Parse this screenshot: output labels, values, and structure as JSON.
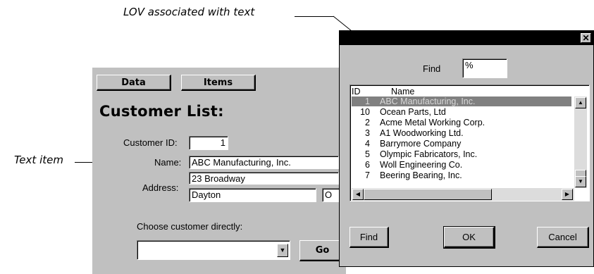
{
  "callouts": {
    "lov": "LOV associated with text",
    "text_item": "Text item"
  },
  "form": {
    "buttons": {
      "data": "Data",
      "items": "Items"
    },
    "title": "Customer List:",
    "customer_id_label": "Customer ID:",
    "customer_id_value": "1",
    "name_label": "Name:",
    "name_value": "ABC Manufacturing, Inc.",
    "address_label": "Address:",
    "address_line1": "23 Broadway",
    "city_value": "Dayton",
    "state_partial": "O",
    "choose_label": "Choose customer directly:",
    "combo_value": "",
    "go_label": "Go"
  },
  "lov_dialog": {
    "close_glyph": "✕",
    "find_label": "Find",
    "find_value": "%",
    "columns": {
      "id": "ID",
      "name": "Name"
    },
    "rows": [
      {
        "id": "1",
        "name": "ABC Manufacturing, Inc.",
        "selected": true
      },
      {
        "id": "10",
        "name": "Ocean Parts, Ltd"
      },
      {
        "id": "2",
        "name": "Acme Metal Working Corp."
      },
      {
        "id": "3",
        "name": "A1 Woodworking Ltd."
      },
      {
        "id": "4",
        "name": "Barrymore Company"
      },
      {
        "id": "5",
        "name": "Olympic Fabricators, Inc."
      },
      {
        "id": "6",
        "name": "Woll Engineering Co."
      },
      {
        "id": "7",
        "name": "Beering Bearing, Inc."
      }
    ],
    "buttons": {
      "find": "Find",
      "ok": "OK",
      "cancel": "Cancel"
    }
  },
  "icons": {
    "close": "close-icon",
    "scroll_up": "arrow-up-icon",
    "scroll_down": "arrow-down-icon",
    "scroll_left": "arrow-left-icon",
    "scroll_right": "arrow-right-icon",
    "combo_drop": "chevron-down-icon"
  },
  "colors": {
    "form_bg": "#c0c0c0",
    "selection_bg": "#808080",
    "title_bar": "#000000"
  }
}
